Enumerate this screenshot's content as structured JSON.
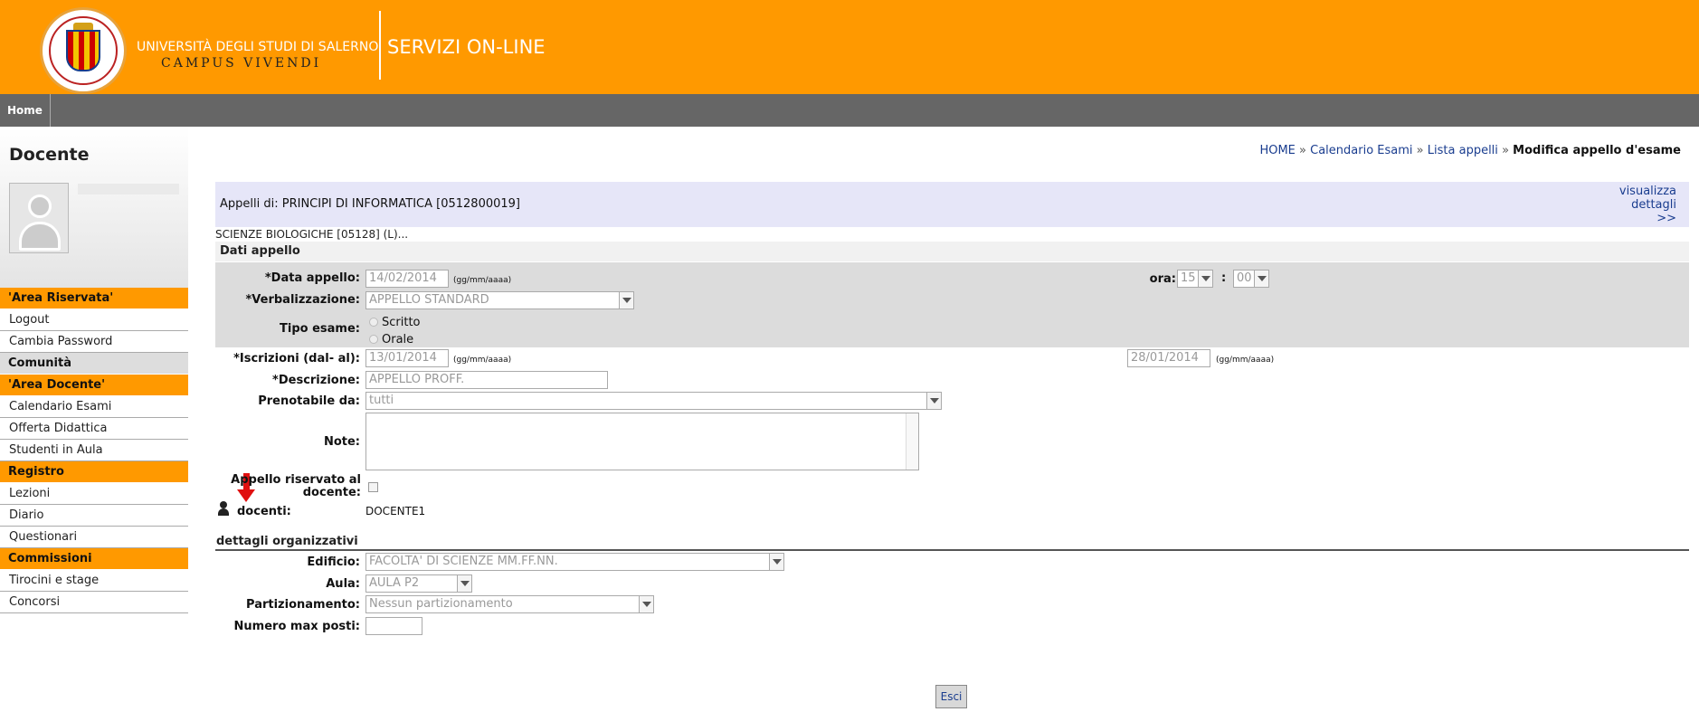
{
  "header": {
    "university_name": "UNIVERSITÀ DEGLI STUDI DI SALERNO",
    "motto": "CAMPUS VIVENDI",
    "service_title": "SERVIZI ON-LINE"
  },
  "nav": {
    "home_label": "Home"
  },
  "sidebar": {
    "title": "Docente",
    "sections": [
      {
        "label": "'Area Riservata'",
        "items": [
          "Logout",
          "Cambia Password"
        ]
      },
      {
        "label": "Comunità",
        "items": []
      },
      {
        "label": "'Area Docente'",
        "items": [
          "Calendario Esami",
          "Offerta Didattica",
          "Studenti in Aula"
        ]
      },
      {
        "label": "Registro",
        "items": [
          "Lezioni",
          "Diario",
          "Questionari"
        ]
      },
      {
        "label": "Commissioni",
        "items": [
          "Tirocini e stage",
          "Concorsi"
        ]
      }
    ]
  },
  "breadcrumb": {
    "home": "HOME",
    "calendario": "Calendario Esami",
    "lista": "Lista appelli",
    "current": "Modifica appello d'esame",
    "separator": "»"
  },
  "appelli": {
    "title": "Appelli di: PRINCIPI DI INFORMATICA [0512800019]",
    "details_link_line1": "visualizza",
    "details_link_line2": "dettagli",
    "details_link_line3": ">>",
    "corso": "SCIENZE BIOLOGICHE [05128] (L)..."
  },
  "dati": {
    "section_label": "Dati appello",
    "data_label": "*Data appello:",
    "data_value": "14/02/2014",
    "date_hint": "(gg/mm/aaaa)",
    "ora_label": "ora:",
    "ora_hour": "15",
    "ora_sep": ":",
    "ora_min": "00",
    "verbal_label": "*Verbalizzazione:",
    "verbal_value": "APPELLO STANDARD",
    "tipo_label": "Tipo esame:",
    "tipo_options": [
      "Scritto",
      "Orale"
    ],
    "iscrizioni_label": "*Iscrizioni (dal- al):",
    "iscrizioni_from": "13/01/2014",
    "iscrizioni_to": "28/01/2014",
    "descrizione_label": "*Descrizione:",
    "descrizione_value": "APPELLO PROFF.",
    "prenotabile_label": "Prenotabile da:",
    "prenotabile_value": "tutti",
    "note_label": "Note:",
    "riservato_label_1": "Appello riservato al",
    "riservato_label_2": "docente:",
    "docenti_label": "docenti:",
    "docenti_value": "DOCENTE1"
  },
  "org": {
    "section_label": "dettagli organizzativi",
    "edificio_label": "Edificio:",
    "edificio_value": "FACOLTA' DI SCIENZE MM.FF.NN.",
    "aula_label": "Aula:",
    "aula_value": "AULA P2",
    "partizionamento_label": "Partizionamento:",
    "partizionamento_value": "Nessun partizionamento",
    "numero_label": "Numero max posti:",
    "numero_value": ""
  },
  "footer": {
    "esci_label": "Esci"
  },
  "colors": {
    "brand_orange": "#FF9900",
    "nav_gray": "#666666",
    "link_blue": "#1a3d8f",
    "annotation_red": "#e01010"
  },
  "icons": [
    "university-seal-icon",
    "user-avatar-icon",
    "docente-icon",
    "red-down-arrow-icon"
  ]
}
